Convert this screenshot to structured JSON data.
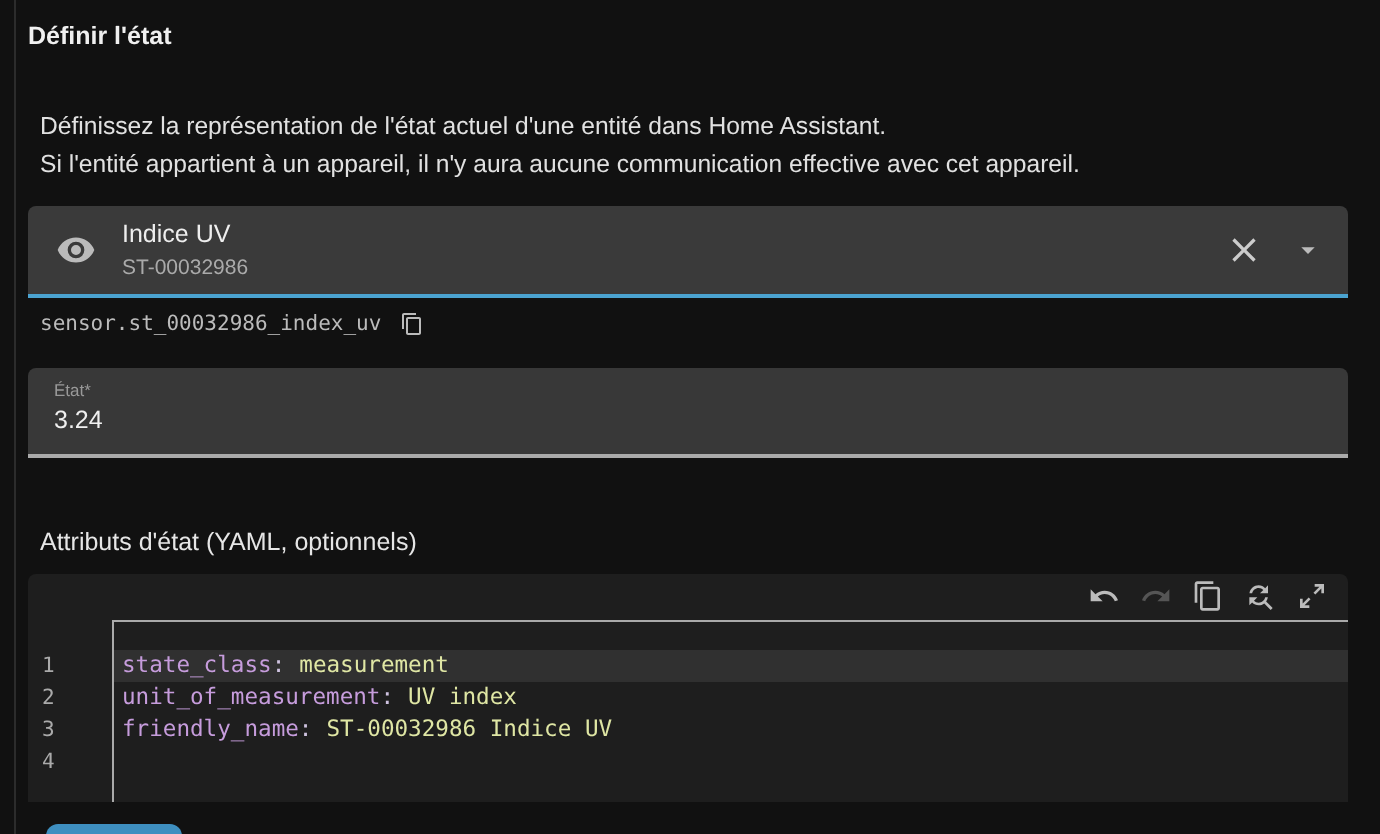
{
  "dialog": {
    "title": "Définir l'état"
  },
  "description": [
    "Définissez la représentation de l'état actuel d'une entité dans Home Assistant.",
    "Si l'entité appartient à un appareil, il n'y aura aucune communication effective avec cet appareil."
  ],
  "entity_picker": {
    "name": "Indice UV",
    "device": "ST-00032986",
    "focused": true
  },
  "entity_id": "sensor.st_00032986_index_uv",
  "state_field": {
    "label": "État*",
    "value": "3.24"
  },
  "attributes_label": "Attributs d'état (YAML, optionnels)",
  "editor": {
    "toolbar": [
      {
        "kind": "undo",
        "disabled": false
      },
      {
        "kind": "redo",
        "disabled": true
      },
      {
        "kind": "copy",
        "disabled": false
      },
      {
        "kind": "replace",
        "disabled": false
      },
      {
        "kind": "fullscreen",
        "disabled": false
      }
    ],
    "lines": [
      {
        "number": "1",
        "key": "state_class",
        "separator": ":",
        "value": "measurement",
        "active": true
      },
      {
        "number": "2",
        "key": "unit_of_measurement",
        "separator": ":",
        "value": "UV index",
        "active": false
      },
      {
        "number": "3",
        "key": "friendly_name",
        "separator": ":",
        "value": "ST-00032986 Indice UV",
        "active": false
      },
      {
        "number": "4",
        "active": false
      }
    ]
  }
}
